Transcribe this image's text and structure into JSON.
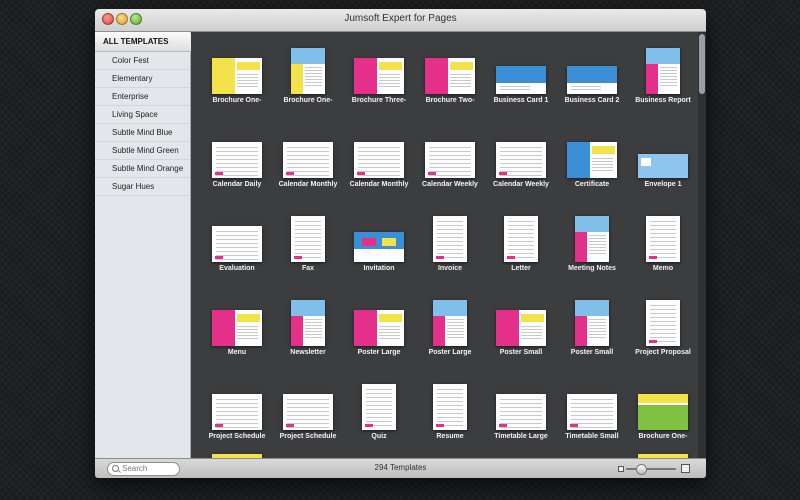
{
  "window": {
    "title": "Jumsoft Expert for Pages"
  },
  "sidebar": {
    "items": [
      {
        "label": "ALL TEMPLATES",
        "active": true
      },
      {
        "label": "Color Fest"
      },
      {
        "label": "Elementary"
      },
      {
        "label": "Enterprise"
      },
      {
        "label": "Living Space"
      },
      {
        "label": "Subtle Mind Blue"
      },
      {
        "label": "Subtle Mind Green"
      },
      {
        "label": "Subtle Mind Orange"
      },
      {
        "label": "Sugar Hues"
      }
    ]
  },
  "templates": [
    {
      "name": "Brochure One-",
      "kind": "landscape",
      "accent": "#f4e24a"
    },
    {
      "name": "Brochure One-",
      "kind": "portrait",
      "accent": "#f4e24a"
    },
    {
      "name": "Brochure Three-",
      "kind": "landscape",
      "accent": "#e5308b"
    },
    {
      "name": "Brochure Two-",
      "kind": "landscape",
      "accent": "#e5308b"
    },
    {
      "name": "Business Card 1",
      "kind": "card",
      "accent": "#3a8fd6"
    },
    {
      "name": "Business Card 2",
      "kind": "card",
      "accent": "#3a8fd6"
    },
    {
      "name": "Business Report",
      "kind": "portrait",
      "accent": "#e5308b"
    },
    {
      "name": "Calendar Daily",
      "kind": "landscape-plain",
      "accent": "#e5308b"
    },
    {
      "name": "Calendar Monthly",
      "kind": "landscape-plain",
      "accent": "#e5308b"
    },
    {
      "name": "Calendar Monthly",
      "kind": "landscape-plain",
      "accent": "#e5308b"
    },
    {
      "name": "Calendar Weekly",
      "kind": "landscape-plain",
      "accent": "#e5308b"
    },
    {
      "name": "Calendar Weekly",
      "kind": "landscape-plain",
      "accent": "#e5308b"
    },
    {
      "name": "Certificate",
      "kind": "landscape",
      "accent": "#3a8fd6"
    },
    {
      "name": "Envelope 1",
      "kind": "envelope",
      "accent": "#3a8fd6"
    },
    {
      "name": "Evaluation",
      "kind": "landscape-plain",
      "accent": "#e5308b"
    },
    {
      "name": "Fax",
      "kind": "portrait-plain",
      "accent": "#e5308b"
    },
    {
      "name": "Invitation",
      "kind": "invitation",
      "accent": "#3a8fd6"
    },
    {
      "name": "Invoice",
      "kind": "portrait-plain",
      "accent": "#e5308b"
    },
    {
      "name": "Letter",
      "kind": "portrait-plain",
      "accent": "#e5308b"
    },
    {
      "name": "Meeting Notes",
      "kind": "portrait",
      "accent": "#e5308b"
    },
    {
      "name": "Memo",
      "kind": "portrait-plain",
      "accent": "#e5308b"
    },
    {
      "name": "Menu",
      "kind": "landscape",
      "accent": "#e5308b"
    },
    {
      "name": "Newsletter",
      "kind": "portrait",
      "accent": "#e5308b"
    },
    {
      "name": "Poster Large",
      "kind": "landscape",
      "accent": "#e5308b"
    },
    {
      "name": "Poster Large",
      "kind": "portrait",
      "accent": "#e5308b"
    },
    {
      "name": "Poster Small",
      "kind": "landscape",
      "accent": "#e5308b"
    },
    {
      "name": "Poster Small",
      "kind": "portrait",
      "accent": "#e5308b"
    },
    {
      "name": "Project Proposal",
      "kind": "portrait-plain",
      "accent": "#e5308b"
    },
    {
      "name": "Project Schedule",
      "kind": "landscape-plain",
      "accent": "#e5308b"
    },
    {
      "name": "Project Schedule",
      "kind": "landscape-plain",
      "accent": "#e5308b"
    },
    {
      "name": "Quiz",
      "kind": "portrait-plain",
      "accent": "#e5308b"
    },
    {
      "name": "Resume",
      "kind": "portrait-plain",
      "accent": "#e5308b"
    },
    {
      "name": "Timetable Large",
      "kind": "landscape-plain",
      "accent": "#e5308b"
    },
    {
      "name": "Timetable Small",
      "kind": "landscape-plain",
      "accent": "#e5308b"
    },
    {
      "name": "Brochure One-",
      "kind": "photo",
      "accent": "#7fc241"
    }
  ],
  "footer": {
    "search_placeholder": "Search",
    "count_label": "294 Templates"
  },
  "colors": {
    "window_bg": "#3c3d3f",
    "sidebar_bg": "#e3e6eb",
    "accent_pink": "#e5308b",
    "accent_yellow": "#f4e24a",
    "accent_blue": "#3a8fd6"
  }
}
